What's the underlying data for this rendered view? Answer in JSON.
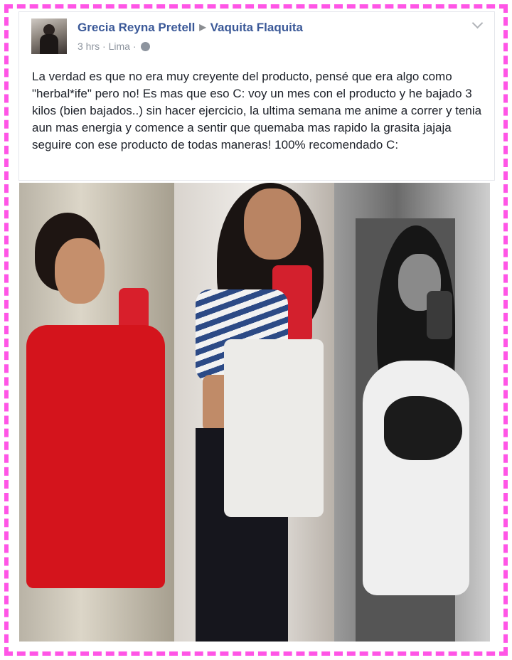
{
  "post": {
    "author": "Grecia Reyna Pretell",
    "group": "Vaquita Flaquita",
    "time": "3 hrs",
    "location": "Lima",
    "separator": "·",
    "privacy_icon": "globe-icon",
    "options_icon": "chevron-down-icon",
    "text": "La verdad es que no era muy creyente del producto, pensé que era algo como \"herbal*ife\" pero no! Es mas que eso C: voy un mes con el producto y he bajado 3 kilos (bien bajados..) sin hacer ejercicio, la ultima semana me anime a correr y tenia aun mas energia y comence a sentir que quemaba mas rapido la grasita jajaja seguire con ese producto de todas maneras! 100% recomendado C:"
  },
  "colors": {
    "frame_border": "#ff55e6",
    "link": "#3b5998",
    "meta": "#8d949e",
    "body_text": "#1d2129"
  }
}
